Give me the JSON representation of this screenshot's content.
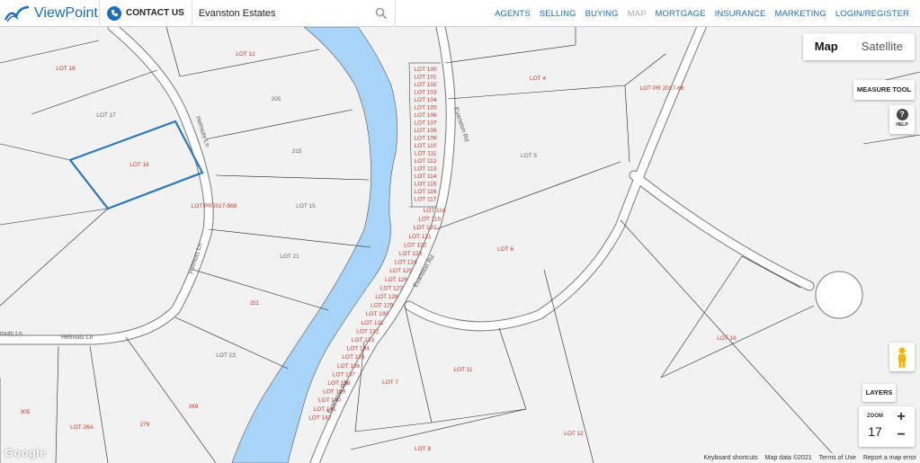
{
  "header": {
    "brand": "ViewPoint",
    "contact_label": "CONTACT US",
    "search_value": "Evanston Estates",
    "nav": [
      {
        "label": "AGENTS",
        "muted": false
      },
      {
        "label": "SELLING",
        "muted": false
      },
      {
        "label": "BUYING",
        "muted": false
      },
      {
        "label": "MAP",
        "muted": true
      },
      {
        "label": "MORTGAGE",
        "muted": false
      },
      {
        "label": "INSURANCE",
        "muted": false
      },
      {
        "label": "MARKETING",
        "muted": false
      },
      {
        "label": "LOGIN/REGISTER",
        "muted": false
      }
    ]
  },
  "map_controls": {
    "map_label": "Map",
    "satellite_label": "Satellite",
    "measure_tool": "MEASURE TOOL",
    "help_label": "HELP",
    "layers_label": "LAYERS",
    "zoom_label": "ZOOM",
    "zoom_level": "17",
    "zoom_in": "+",
    "zoom_out": "−"
  },
  "map": {
    "roads": {
      "helmuts_ln_north": "Helmuts Ln",
      "helmuts_ln_west": "Helmuts Ln",
      "helmuts_ln_corner": "Helmuts Ln",
      "evanston_rd_north": "Evanston Rd",
      "evanston_rd_mid": "Evanston Rd",
      "evanston_rd_south": "Evanston Rd",
      "muts_ln": "muts Ln"
    },
    "lots_left": {
      "lot18": "LOT 18",
      "lot12a": "LOT 12",
      "n205": "205",
      "lot17": "LOT 17",
      "lot16": "LOT 16",
      "n215": "215",
      "lotpr568": "LOT PR2017-568",
      "lot15": "LOT 15",
      "lot21": "LOT 21",
      "n251": "251",
      "lot23": "LOT 23",
      "n269": "269",
      "n279": "279",
      "lot26a": "LOT 26A",
      "n305": "305"
    },
    "lots_right": {
      "lot4": "LOT 4",
      "lotpr66": "LOT PR 2017-66",
      "lot5": "LOT 5",
      "lot6": "LOT 6",
      "lot16b": "LOT 16",
      "lot11": "LOT 11",
      "lot7": "LOT 7",
      "lot12b": "LOT 12",
      "lot8": "LOT 8"
    },
    "small_lots_north": [
      "LOT 100",
      "LOT 101",
      "LOT 102",
      "LOT 103",
      "LOT 104",
      "LOT 105",
      "LOT 106",
      "LOT 107",
      "LOT 108",
      "LOT 109",
      "LOT 110",
      "LOT 111",
      "LOT 112",
      "LOT 113",
      "LOT 114",
      "LOT 115",
      "LOT 116",
      "LOT 117"
    ],
    "small_lots_south": [
      "LOT 118",
      "LOT 119",
      "LOT 120",
      "LOT 121",
      "LOT 122",
      "LOT 123",
      "LOT 124",
      "LOT 125",
      "LOT 126",
      "LOT 127",
      "LOT 128",
      "LOT 129",
      "LOT 130",
      "LOT 131",
      "LOT 132",
      "LOT 133",
      "LOT 134",
      "LOT 135",
      "LOT 136",
      "LOT 137",
      "LOT 138",
      "LOT 139",
      "LOT 140",
      "LOT 141",
      "LOT 142"
    ]
  },
  "footer": {
    "google": "Google",
    "shortcuts": "Keyboard shortcuts",
    "map_data": "Map data ©2021",
    "terms": "Terms of Use",
    "report": "Report a map error"
  },
  "colors": {
    "accent": "#1e6db5",
    "river": "#a8d4f8",
    "parcel_line": "#222222",
    "selected_parcel": "#2b78b8",
    "lot_label": "#c0392b"
  }
}
